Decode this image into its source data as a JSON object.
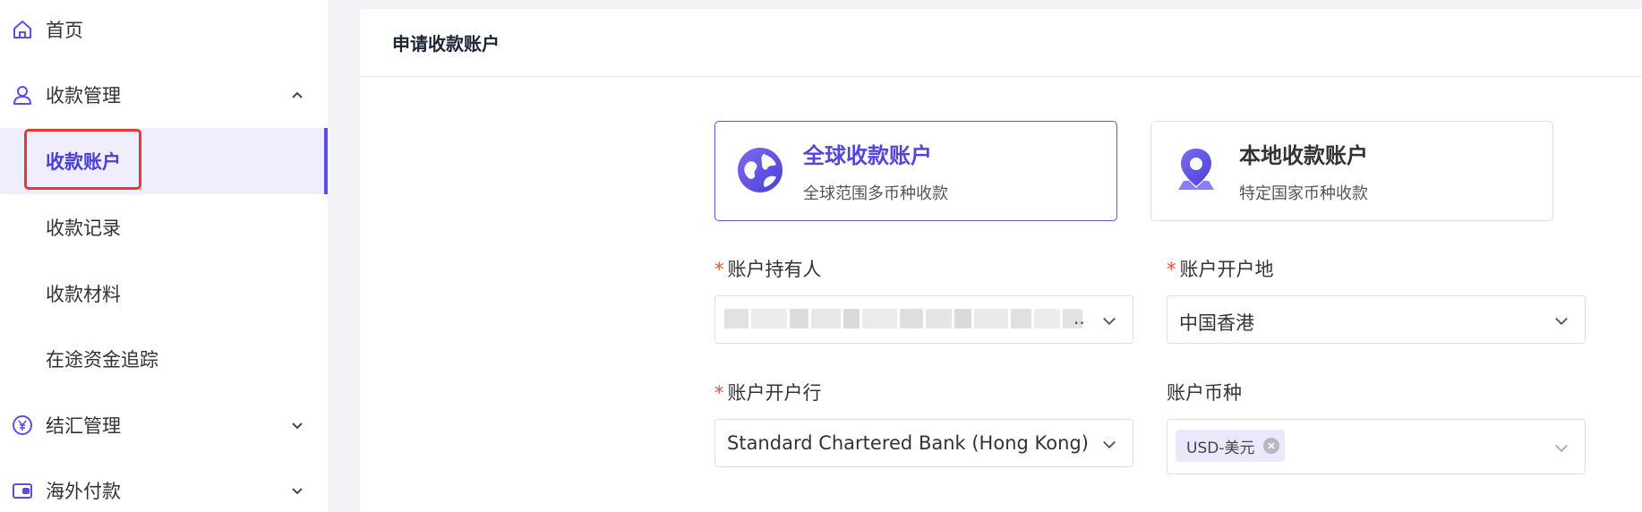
{
  "sidebar": {
    "items": [
      {
        "label": "首页",
        "icon": "home-icon"
      },
      {
        "label": "收款管理",
        "icon": "user-icon",
        "expanded": true
      },
      {
        "label": "结汇管理",
        "icon": "yen-icon",
        "expanded": false
      },
      {
        "label": "海外付款",
        "icon": "wallet-icon",
        "expanded": false
      }
    ],
    "sub_items": [
      {
        "label": "收款账户",
        "active": true
      },
      {
        "label": "收款记录"
      },
      {
        "label": "收款材料"
      },
      {
        "label": "在途资金追踪"
      }
    ]
  },
  "main": {
    "title": "申请收款账户",
    "account_types": [
      {
        "title": "全球收款账户",
        "subtitle": "全球范围多币种收款",
        "icon": "globe-icon",
        "selected": true
      },
      {
        "title": "本地收款账户",
        "subtitle": "特定国家币种收款",
        "icon": "location-pin-icon",
        "selected": false
      }
    ],
    "form": {
      "holder": {
        "label": "账户持有人",
        "required": true,
        "value": ""
      },
      "region": {
        "label": "账户开户地",
        "required": true,
        "value": "中国香港"
      },
      "bank": {
        "label": "账户开户行",
        "required": true,
        "value": "Standard Chartered Bank (Hong Kong) Li..."
      },
      "currency": {
        "label": "账户币种",
        "required": false,
        "tags": [
          "USD-美元"
        ]
      }
    },
    "required_mark": "*"
  },
  "colors": {
    "accent": "#5b4ee0",
    "active_bg": "#f0eefc",
    "required": "#e8502e",
    "highlight": "#e53935"
  }
}
